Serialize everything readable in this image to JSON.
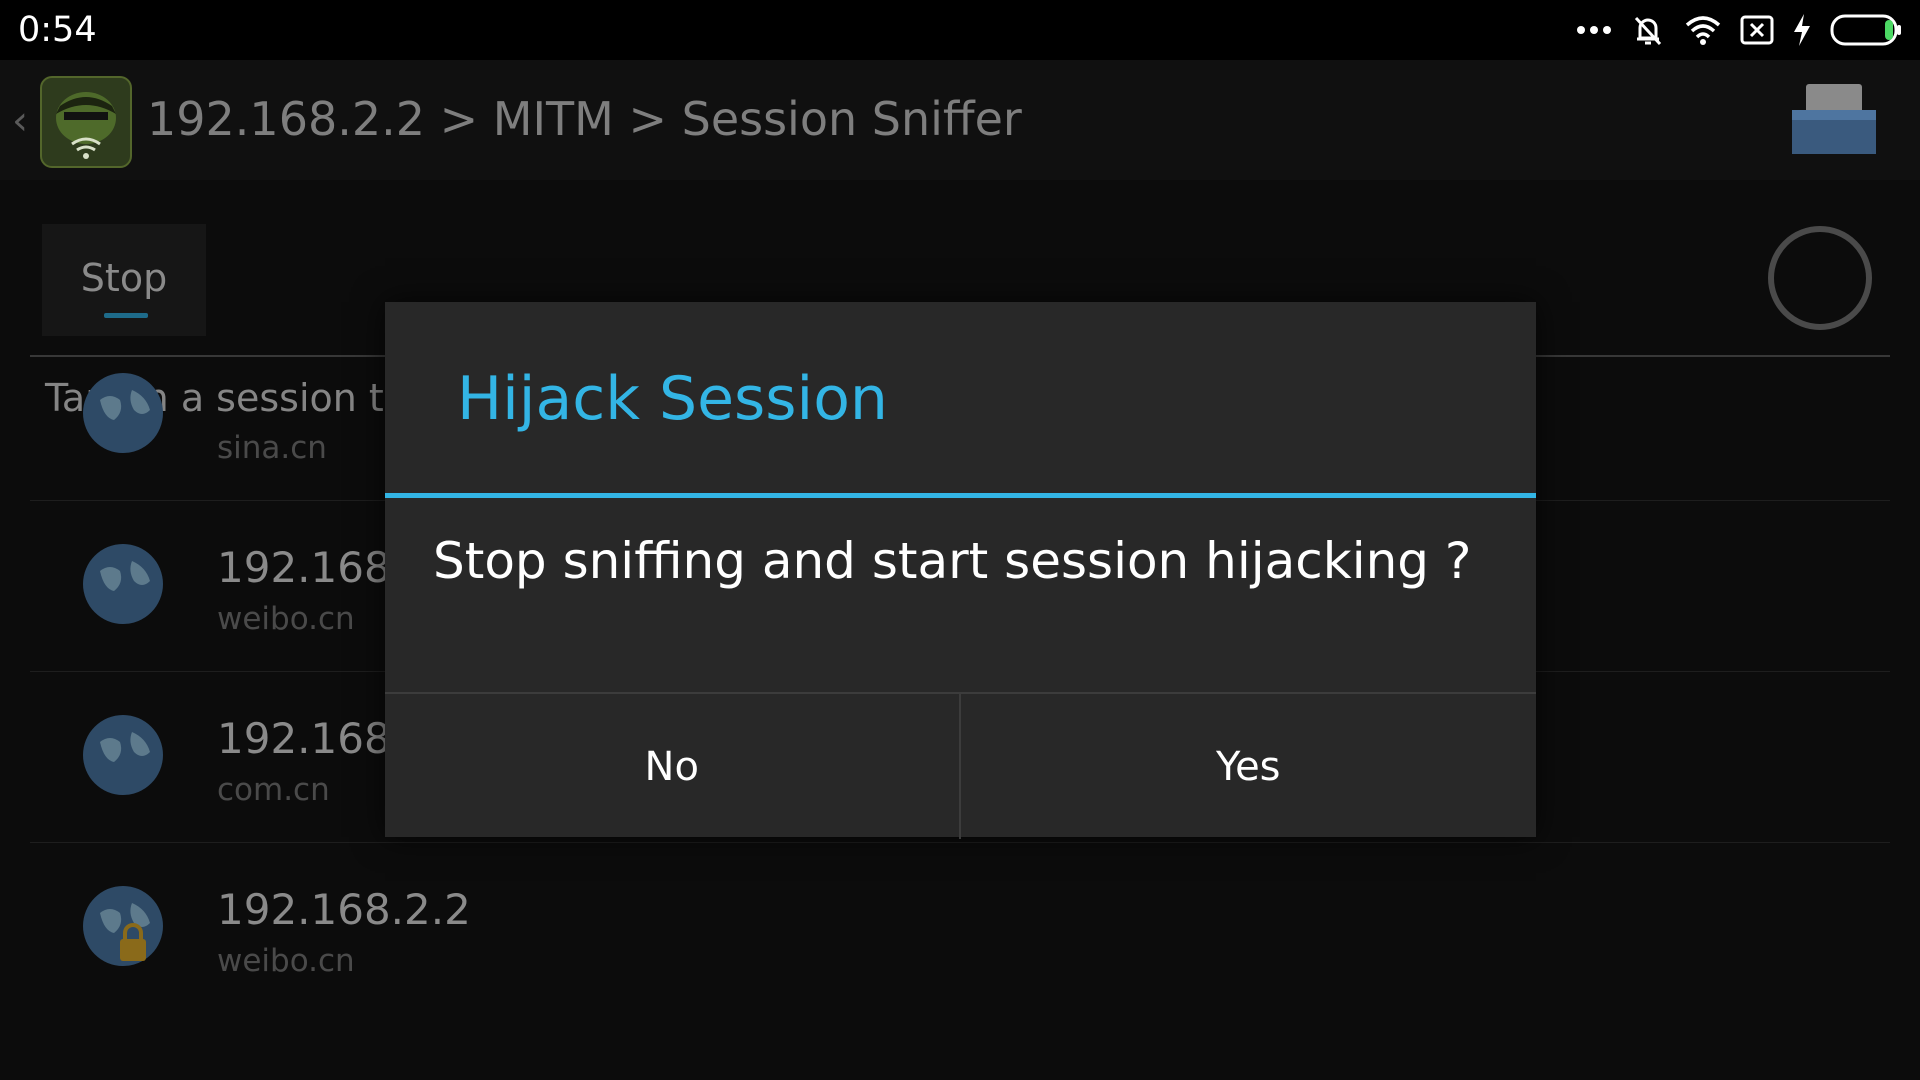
{
  "status_bar": {
    "time": "0:54",
    "icons": [
      "more-dots-icon",
      "bell-muted-icon",
      "wifi-icon",
      "sim-off-icon",
      "charging-bolt-icon",
      "battery-icon"
    ]
  },
  "app_bar": {
    "breadcrumb": "192.168.2.2 > MITM > Session Sniffer",
    "icons": [
      "back-chevron-icon",
      "app-logo",
      "tray-icon"
    ]
  },
  "content": {
    "stop_tab_label": "Stop",
    "hint_text": "Tap on a session t",
    "sessions": [
      {
        "ip": "",
        "domain": "sina.cn"
      },
      {
        "ip": "192.168.",
        "domain": "weibo.cn"
      },
      {
        "ip": "192.168.",
        "domain": "com.cn"
      },
      {
        "ip": "192.168.2.2",
        "domain": "weibo.cn"
      }
    ]
  },
  "dialog": {
    "title": "Hijack Session",
    "message": "Stop sniffing and start session hijacking ?",
    "no_label": "No",
    "yes_label": "Yes"
  },
  "colors": {
    "accent": "#33b5e5",
    "dialog_background": "#282828",
    "screen_background": "#0c0c0c"
  }
}
